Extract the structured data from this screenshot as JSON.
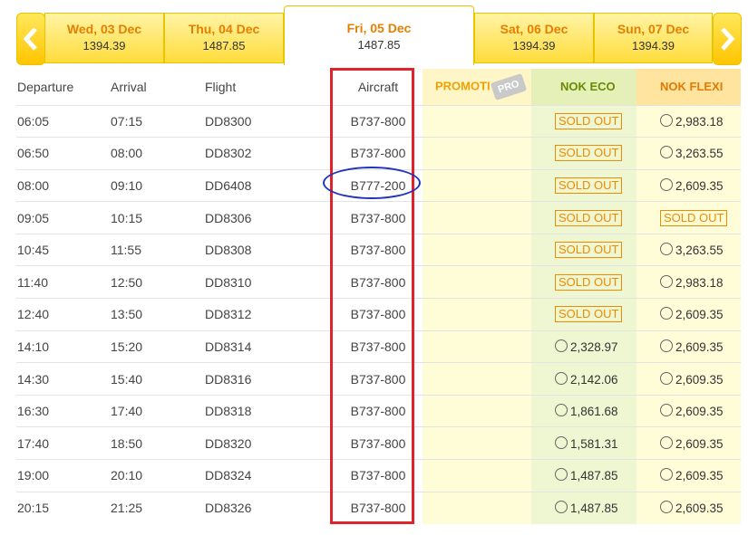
{
  "date_tabs": [
    {
      "label": "Wed, 03 Dec",
      "price": "1394.39",
      "active": false
    },
    {
      "label": "Thu, 04 Dec",
      "price": "1487.85",
      "active": false
    },
    {
      "label": "Fri, 05 Dec",
      "price": "1487.85",
      "active": true
    },
    {
      "label": "Sat, 06 Dec",
      "price": "1394.39",
      "active": false
    },
    {
      "label": "Sun, 07 Dec",
      "price": "1394.39",
      "active": false
    }
  ],
  "headers": {
    "departure": "Departure",
    "arrival": "Arrival",
    "flight": "Flight",
    "aircraft": "Aircraft",
    "promo": "PROMOTI",
    "promo_tag": "PRO",
    "nok_eco": "NOK ECO",
    "nok_flexi": "NOK FLEXI"
  },
  "sold_out_label": "SOLD OUT",
  "flights": [
    {
      "dep": "06:05",
      "arr": "07:15",
      "flight": "DD8300",
      "aircraft": "B737-800",
      "eco": null,
      "flexi": "2,983.18"
    },
    {
      "dep": "06:50",
      "arr": "08:00",
      "flight": "DD8302",
      "aircraft": "B737-800",
      "eco": null,
      "flexi": "3,263.55"
    },
    {
      "dep": "08:00",
      "arr": "09:10",
      "flight": "DD6408",
      "aircraft": "B777-200",
      "eco": null,
      "flexi": "2,609.35"
    },
    {
      "dep": "09:05",
      "arr": "10:15",
      "flight": "DD8306",
      "aircraft": "B737-800",
      "eco": null,
      "flexi": null
    },
    {
      "dep": "10:45",
      "arr": "11:55",
      "flight": "DD8308",
      "aircraft": "B737-800",
      "eco": null,
      "flexi": "3,263.55"
    },
    {
      "dep": "11:40",
      "arr": "12:50",
      "flight": "DD8310",
      "aircraft": "B737-800",
      "eco": null,
      "flexi": "2,983.18"
    },
    {
      "dep": "12:40",
      "arr": "13:50",
      "flight": "DD8312",
      "aircraft": "B737-800",
      "eco": null,
      "flexi": "2,609.35"
    },
    {
      "dep": "14:10",
      "arr": "15:20",
      "flight": "DD8314",
      "aircraft": "B737-800",
      "eco": "2,328.97",
      "flexi": "2,609.35"
    },
    {
      "dep": "14:30",
      "arr": "15:40",
      "flight": "DD8316",
      "aircraft": "B737-800",
      "eco": "2,142.06",
      "flexi": "2,609.35"
    },
    {
      "dep": "16:30",
      "arr": "17:40",
      "flight": "DD8318",
      "aircraft": "B737-800",
      "eco": "1,861.68",
      "flexi": "2,609.35"
    },
    {
      "dep": "17:40",
      "arr": "18:50",
      "flight": "DD8320",
      "aircraft": "B737-800",
      "eco": "1,581.31",
      "flexi": "2,609.35"
    },
    {
      "dep": "19:00",
      "arr": "20:10",
      "flight": "DD8324",
      "aircraft": "B737-800",
      "eco": "1,487.85",
      "flexi": "2,609.35"
    },
    {
      "dep": "20:15",
      "arr": "21:25",
      "flight": "DD8326",
      "aircraft": "B737-800",
      "eco": "1,487.85",
      "flexi": "2,609.35"
    }
  ],
  "colors": {
    "brand_yellow": "#ffd21e",
    "sold_out_orange": "#f08a00",
    "annotation_red": "#e0222a",
    "annotation_blue": "#2233bb"
  }
}
